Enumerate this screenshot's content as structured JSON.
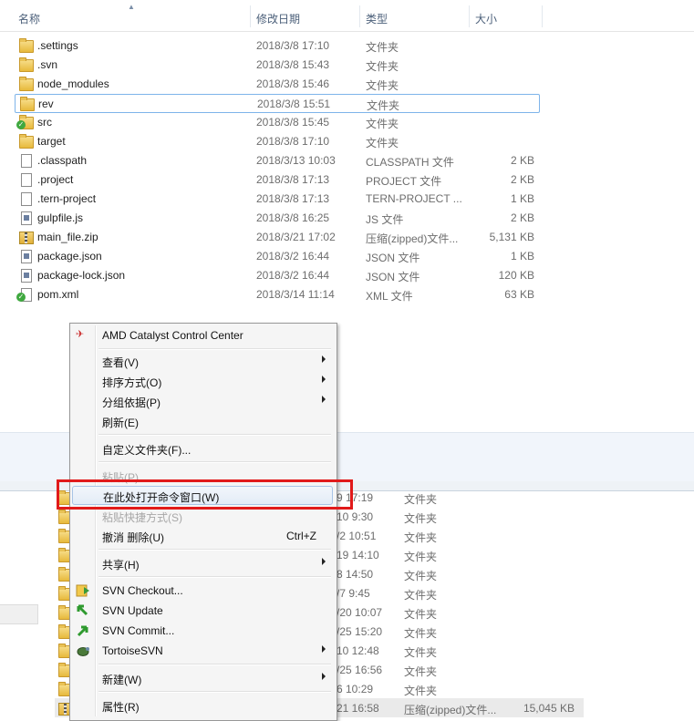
{
  "header": {
    "name_label": "名称",
    "date_label": "修改日期",
    "type_label": "类型",
    "size_label": "大小"
  },
  "files": [
    {
      "name": ".settings",
      "date": "2018/3/8 17:10",
      "type": "文件夹",
      "size": "",
      "icon": "folder-icon"
    },
    {
      "name": ".svn",
      "date": "2018/3/8 15:43",
      "type": "文件夹",
      "size": "",
      "icon": "folder-icon"
    },
    {
      "name": "node_modules",
      "date": "2018/3/8 15:46",
      "type": "文件夹",
      "size": "",
      "icon": "folder-icon"
    },
    {
      "name": "rev",
      "date": "2018/3/8 15:51",
      "type": "文件夹",
      "size": "",
      "icon": "folder-icon"
    },
    {
      "name": "src",
      "date": "2018/3/8 15:45",
      "type": "文件夹",
      "size": "",
      "icon": "svn-folder-icon"
    },
    {
      "name": "target",
      "date": "2018/3/8 17:10",
      "type": "文件夹",
      "size": "",
      "icon": "folder-icon"
    },
    {
      "name": ".classpath",
      "date": "2018/3/13 10:03",
      "type": "CLASSPATH 文件",
      "size": "2 KB",
      "icon": "file-icon"
    },
    {
      "name": ".project",
      "date": "2018/3/8 17:13",
      "type": "PROJECT 文件",
      "size": "2 KB",
      "icon": "file-icon"
    },
    {
      "name": ".tern-project",
      "date": "2018/3/8 17:13",
      "type": "TERN-PROJECT ...",
      "size": "1 KB",
      "icon": "file-icon"
    },
    {
      "name": "gulpfile.js",
      "date": "2018/3/8 16:25",
      "type": "JS 文件",
      "size": "2 KB",
      "icon": "js-file-icon"
    },
    {
      "name": "main_file.zip",
      "date": "2018/3/21 17:02",
      "type": "压缩(zipped)文件...",
      "size": "5,131 KB",
      "icon": "zip-icon"
    },
    {
      "name": "package.json",
      "date": "2018/3/2 16:44",
      "type": "JSON 文件",
      "size": "1 KB",
      "icon": "json-file-icon"
    },
    {
      "name": "package-lock.json",
      "date": "2018/3/2 16:44",
      "type": "JSON 文件",
      "size": "120 KB",
      "icon": "json-file-icon"
    },
    {
      "name": "pom.xml",
      "date": "2018/3/14 11:14",
      "type": "XML 文件",
      "size": "63 KB",
      "icon": "svn-xml-icon"
    }
  ],
  "bottom_rows": [
    {
      "date": "9 17:19",
      "type": "文件夹",
      "size": ""
    },
    {
      "date": "10 9:30",
      "type": "文件夹",
      "size": ""
    },
    {
      "date": "/2 10:51",
      "type": "文件夹",
      "size": ""
    },
    {
      "date": "19 14:10",
      "type": "文件夹",
      "size": ""
    },
    {
      "date": "8 14:50",
      "type": "文件夹",
      "size": ""
    },
    {
      "date": "/7 9:45",
      "type": "文件夹",
      "size": ""
    },
    {
      "date": "/20 10:07",
      "type": "文件夹",
      "size": ""
    },
    {
      "date": "/25 15:20",
      "type": "文件夹",
      "size": ""
    },
    {
      "date": "10 12:48",
      "type": "文件夹",
      "size": ""
    },
    {
      "date": "/25 16:56",
      "type": "文件夹",
      "size": ""
    },
    {
      "date": "6 10:29",
      "type": "文件夹",
      "size": ""
    },
    {
      "date": "21 16:58",
      "type": "压缩(zipped)文件...",
      "size": "15,045 KB"
    }
  ],
  "context_menu": {
    "amd": "AMD Catalyst Control Center",
    "view": "查看(V)",
    "sort": "排序方式(O)",
    "group": "分组依据(P)",
    "refresh": "刷新(E)",
    "customize": "自定义文件夹(F)...",
    "paste": "粘贴(P)",
    "open_cmd": "在此处打开命令窗口(W)",
    "paste_shortcut": "粘贴快捷方式(S)",
    "undo_delete": "撤消 删除(U)",
    "undo_shortcut": "Ctrl+Z",
    "share": "共享(H)",
    "svn_checkout": "SVN Checkout...",
    "svn_update": "SVN Update",
    "svn_commit": "SVN Commit...",
    "tortoise": "TortoiseSVN",
    "new": "新建(W)",
    "properties": "属性(R)"
  },
  "colors": {
    "highlight_border": "#e11a1a",
    "selection_border": "#7eb4ea",
    "svn_green": "#3fa83f"
  }
}
